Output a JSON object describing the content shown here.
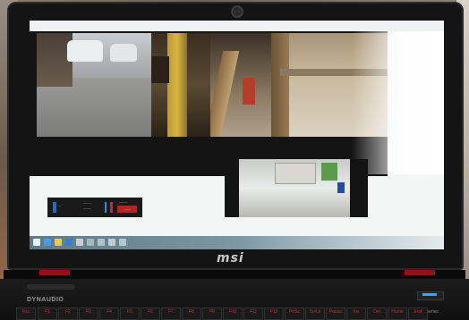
{
  "laptop": {
    "brand": "msi",
    "speaker_brand": "DYNAUDIO",
    "keyboard_brand": "steelseries"
  },
  "status_panel": {
    "left_label": "—",
    "mid_label_top": "———",
    "mid_label_bottom": "———",
    "button_title": "———",
    "button_label": "——"
  },
  "taskbar": {
    "icons": [
      "start-icon",
      "internet-explorer-icon",
      "file-explorer-icon",
      "media-player-icon",
      "app-icon",
      "app-icon",
      "app-icon",
      "app-icon",
      "app-icon"
    ]
  },
  "keyboard": {
    "keys": [
      "Esc",
      "F1",
      "F2",
      "F3",
      "F4",
      "F5",
      "F6",
      "F7",
      "F8",
      "F9",
      "F10",
      "F11",
      "F12",
      "PrtSc",
      "ScrLk",
      "Pause",
      "Ins",
      "Del",
      "Home",
      "End"
    ]
  },
  "colors": {
    "screen_bg": "#f4f6f6",
    "camera_bg": "#141414",
    "status_red": "#b42424",
    "status_blue": "#4a86c8",
    "hinge_accent": "#8c1414"
  }
}
